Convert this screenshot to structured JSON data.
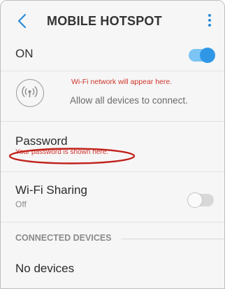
{
  "header": {
    "title": "MOBILE HOTSPOT",
    "back_icon": "chevron-left-icon",
    "more_icon": "more-vertical-icon",
    "accent_color": "#2a8bd8"
  },
  "master_switch": {
    "label": "ON",
    "state": "on"
  },
  "network": {
    "icon": "wifi-hotspot-icon",
    "note": "Wi-Fi network will appear here.",
    "allow_text": "Allow all devices to connect."
  },
  "password": {
    "label": "Password",
    "note": "Your password is shown here.",
    "highlight_color": "#c0201a"
  },
  "wifi_sharing": {
    "label": "Wi-Fi Sharing",
    "status": "Off",
    "state": "off"
  },
  "connected_devices": {
    "section_title": "CONNECTED DEVICES",
    "empty_text": "No devices"
  }
}
